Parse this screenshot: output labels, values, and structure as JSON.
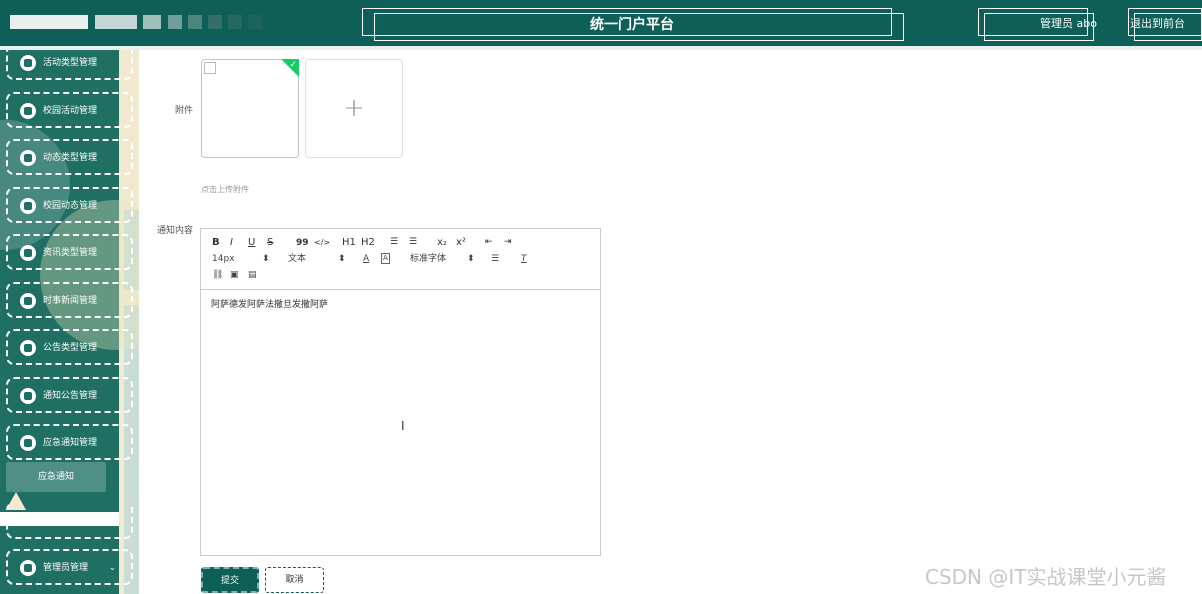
{
  "header": {
    "title": "统一门户平台",
    "user_label": "管理员 abo",
    "logout_label": "退出到前台",
    "bg_color": "#0e5f57"
  },
  "sidebar": {
    "items": [
      {
        "label": "活动类型管理",
        "icon": "menu-icon"
      },
      {
        "label": "校园活动管理",
        "icon": "grid-icon"
      },
      {
        "label": "动态类型管理",
        "icon": "menu-icon"
      },
      {
        "label": "校园动态管理",
        "icon": "chat-icon"
      },
      {
        "label": "资讯类型管理",
        "icon": "menu-icon"
      },
      {
        "label": "时事新闻管理",
        "icon": "grid-icon"
      },
      {
        "label": "公告类型管理",
        "icon": "menu-icon"
      },
      {
        "label": "通知公告管理",
        "icon": "grid-icon"
      },
      {
        "label": "应急通知管理",
        "icon": "cloud-icon"
      },
      {
        "label": "管理员管理",
        "icon": "user-icon"
      }
    ],
    "sub_item": "应急通知",
    "accent_color": "#1f6f62"
  },
  "form": {
    "attachment_label": "附件",
    "upload_hint": "点击上传附件",
    "add_symbol": "+",
    "content_label": "通知内容",
    "editor": {
      "toolbar_row1": [
        "B",
        "I",
        "U",
        "S",
        "99",
        "</>",
        "H1",
        "H2",
        "ol",
        "ul",
        "x2",
        "x2",
        "outdent",
        "indent"
      ],
      "font_size": "14px",
      "paragraph": "文本",
      "font_family": "标准字体",
      "text": "阿萨德发阿萨法撒旦发撒阿萨"
    },
    "submit_label": "提交",
    "cancel_label": "取消"
  },
  "watermark": "CSDN @IT实战课堂小元酱"
}
